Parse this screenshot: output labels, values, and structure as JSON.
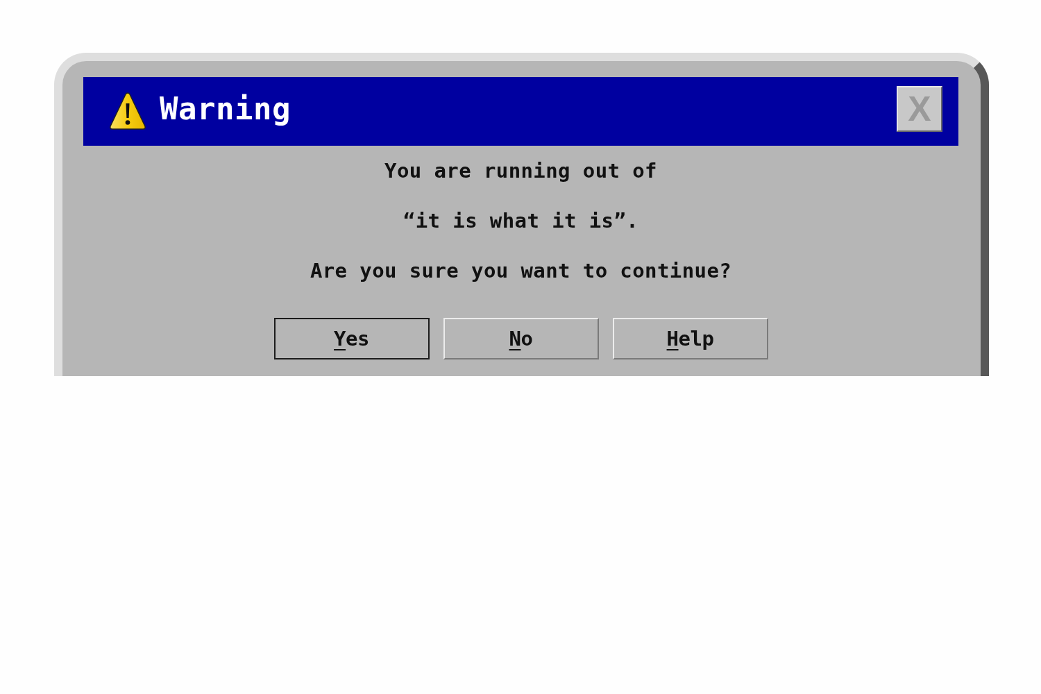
{
  "window": {
    "title": "Warning",
    "close_button": "X"
  },
  "message": {
    "lines": [
      "You are running out of",
      "“it is what it is”.",
      "Are you sure you want to continue?"
    ]
  },
  "buttons": [
    {
      "label": "Yes",
      "default": true,
      "mnemonic_underlined": true
    },
    {
      "label": "No",
      "default": false,
      "mnemonic_underlined": true
    },
    {
      "label": "Help",
      "default": false,
      "mnemonic_underlined": true
    }
  ]
}
